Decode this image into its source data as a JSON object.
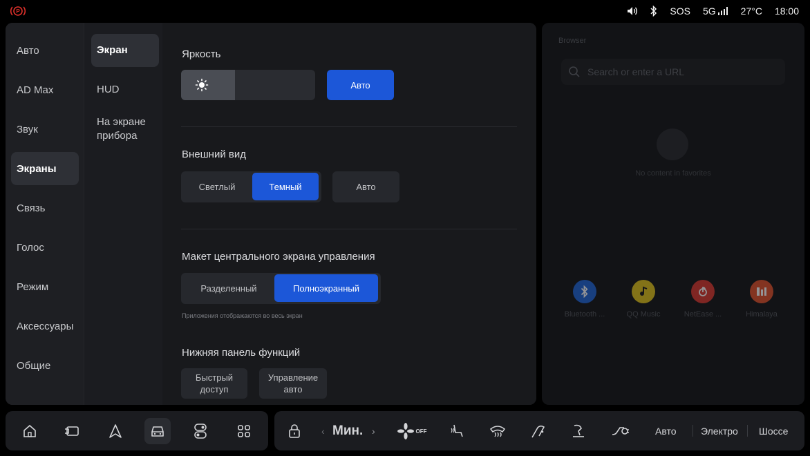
{
  "status_bar": {
    "sos": "SOS",
    "network": "5G",
    "temperature": "27°C",
    "time": "18:00",
    "icons": [
      "parking-brake-icon",
      "volume-icon",
      "bluetooth-icon",
      "signal-icon"
    ]
  },
  "settings": {
    "categories": [
      "Авто",
      "AD Max",
      "Звук",
      "Экраны",
      "Связь",
      "Голос",
      "Режим",
      "Аксессуары",
      "Общие"
    ],
    "active_category": "Экраны",
    "subcategories": [
      "Экран",
      "HUD",
      "На экране прибора"
    ],
    "active_subcategory": "Экран",
    "brightness": {
      "title": "Яркость",
      "level": 0.4,
      "auto_label": "Авто"
    },
    "appearance": {
      "title": "Внешний вид",
      "options": [
        "Светлый",
        "Темный"
      ],
      "selected": "Темный",
      "auto_label": "Авто"
    },
    "layout": {
      "title": "Макет центрального экрана управления",
      "options": [
        "Разделенный",
        "Полноэкранный"
      ],
      "selected": "Полноэкранный",
      "hint": "Приложения отображаются во весь экран"
    },
    "bottom_bar": {
      "title": "Нижняя панель функций",
      "options": [
        "Быстрый доступ",
        "Управление авто"
      ]
    }
  },
  "browser": {
    "title": "Browser",
    "search_placeholder": "Search or enter a URL",
    "empty_text": "No content in favorites",
    "apps": [
      {
        "label": "Bluetooth ...",
        "color": "#1e63d6",
        "icon": "bluetooth-app-icon"
      },
      {
        "label": "QQ Music",
        "color": "#e0c21a",
        "icon": "qq-music-icon"
      },
      {
        "label": "NetEase ...",
        "color": "#d8362e",
        "icon": "netease-music-icon"
      },
      {
        "label": "Himalaya",
        "color": "#e0502a",
        "icon": "himalaya-icon"
      }
    ]
  },
  "dock": {
    "left_icons": [
      "home-icon",
      "wallet-icon",
      "navigation-icon",
      "car-icon",
      "toggle-icon",
      "apps-grid-icon"
    ],
    "fan_speed": "Мин.",
    "fan_status": "OFF",
    "modes": [
      "Авто",
      "Электро",
      "Шоссе"
    ]
  }
}
